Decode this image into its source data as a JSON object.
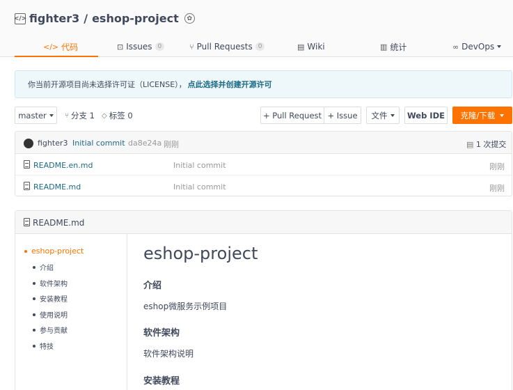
{
  "repo": {
    "owner": "fighter3",
    "separator": "/",
    "name": "eshop-project"
  },
  "tabs": [
    {
      "icon": "code-icon",
      "label": "代码"
    },
    {
      "icon": "issues-icon",
      "label": "Issues",
      "count": "0"
    },
    {
      "icon": "pull-request-icon",
      "label": "Pull Requests",
      "count": "0"
    },
    {
      "icon": "wiki-icon",
      "label": "Wiki"
    },
    {
      "icon": "chart-icon",
      "label": "统计"
    },
    {
      "icon": "devops-icon",
      "label": "DevOps"
    }
  ],
  "license": {
    "text": "你当前开源项目尚未选择许可证（LICENSE），",
    "link": "点此选择并创建开源许可"
  },
  "toolbar": {
    "branch": "master",
    "branches": "分支 1",
    "tags": "标签 0",
    "pull_request": "+ Pull Request",
    "issue": "+ Issue",
    "files": "文件",
    "web_ide": "Web IDE",
    "clone": "克隆/下载"
  },
  "latest_commit": {
    "author": "fighter3",
    "message": "Initial commit",
    "hash": "da8e24a",
    "time": "刚刚",
    "commits": "1 次提交"
  },
  "files": [
    {
      "name": "README.en.md",
      "commit": "Initial commit",
      "time": "刚刚"
    },
    {
      "name": "README.md",
      "commit": "Initial commit",
      "time": "刚刚"
    }
  ],
  "readme": {
    "filename": "README.md",
    "toc": [
      "eshop-project",
      "介绍",
      "软件架构",
      "安装教程",
      "使用说明",
      "参与贡献",
      "特技"
    ],
    "title": "eshop-project",
    "sections": [
      {
        "heading": "介绍",
        "body": "eshop微服务示例项目"
      },
      {
        "heading": "软件架构",
        "body": "软件架构说明"
      },
      {
        "heading": "安装教程",
        "body": ""
      }
    ]
  },
  "colors": {
    "accent": "#fe7300",
    "link": "#1d6a86",
    "text": "#40485b"
  }
}
